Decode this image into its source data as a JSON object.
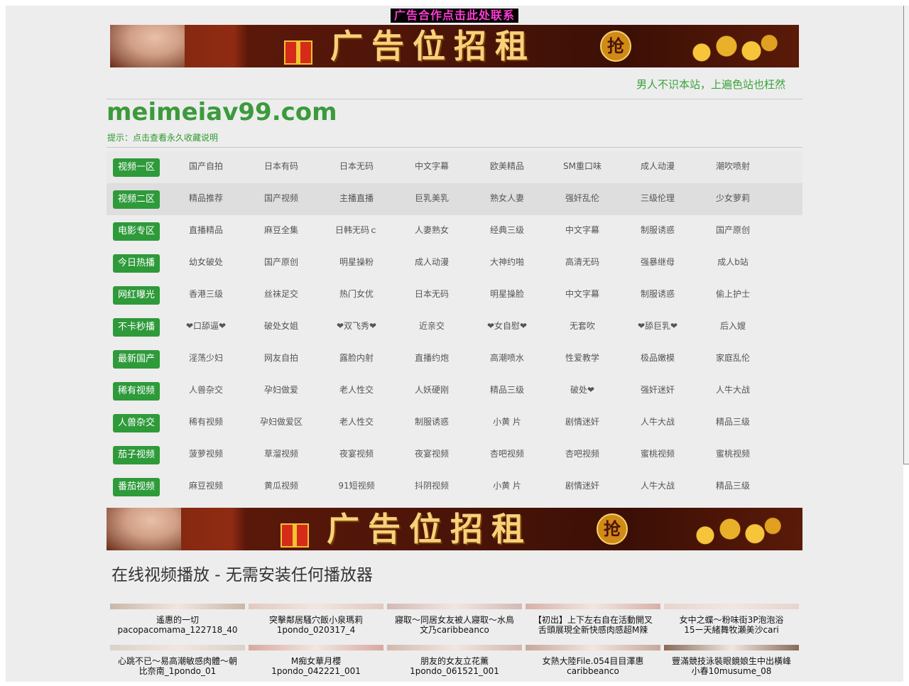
{
  "top_ad_link": "广告合作点击此处联系",
  "banner": {
    "slogan": "广告位招租",
    "badge": "抢"
  },
  "tagline": "男人不识本站，上遍色站也枉然",
  "logo": "meimeiav99.com",
  "hint": "提示：点击查看永久收藏说明",
  "nav": [
    {
      "zone": "视频一区",
      "links": [
        "国产自拍",
        "日本有码",
        "日本无码",
        "中文字幕",
        "欧美精品",
        "SM重口味",
        "成人动漫",
        "潮吹喷射"
      ]
    },
    {
      "zone": "视频二区",
      "links": [
        "精品推荐",
        "国产视频",
        "主播直播",
        "巨乳美乳",
        "熟女人妻",
        "强奸乱伦",
        "三级伦理",
        "少女萝莉"
      ]
    },
    {
      "zone": "电影专区",
      "links": [
        "直播精品",
        "麻豆全集",
        "日韩无码ｃ",
        "人妻熟女",
        "经典三级",
        "中文字幕",
        "制服诱惑",
        "国产原创"
      ]
    },
    {
      "zone": "今日热播",
      "links": [
        "幼女破处",
        "国产原创",
        "明星操粉",
        "成人动漫",
        "大神约啪",
        "高清无码",
        "强暴继母",
        "成人b站"
      ]
    },
    {
      "zone": "网红曝光",
      "links": [
        "香港三级",
        "丝袜足交",
        "热门女优",
        "日本无码",
        "明星操脸",
        "中文字幕",
        "制服诱惑",
        "偷上护士"
      ]
    },
    {
      "zone": "不卡秒播",
      "links": [
        "❤口舔逼❤",
        "破处女姐",
        "❤双飞秀❤",
        "近亲交",
        "❤女自慰❤",
        "无套吹",
        "❤舔巨乳❤",
        "后入嫂"
      ]
    },
    {
      "zone": "最新国产",
      "links": [
        "淫荡少妇",
        "网友自拍",
        "露脸内射",
        "直播约炮",
        "高潮喷水",
        "性爱教学",
        "极品嫩模",
        "家庭乱伦"
      ]
    },
    {
      "zone": "稀有视频",
      "links": [
        "人兽杂交",
        "孕妇做爱",
        "老人性交",
        "人妖硬刚",
        "精品三级",
        "破处❤",
        "强奸迷奸",
        "人牛大战"
      ]
    },
    {
      "zone": "人兽杂交",
      "links": [
        "稀有视频",
        "孕妇做爱区",
        "老人性交",
        "制服诱惑",
        "小黄 片",
        "剧情迷奸",
        "人牛大战",
        "精品三级"
      ]
    },
    {
      "zone": "茄子视频",
      "links": [
        "菠萝视频",
        "草溜视频",
        "夜宴视频",
        "夜宴视频",
        "杏吧视频",
        "杏吧视频",
        "蜜桃视频",
        "蜜桃视频"
      ]
    },
    {
      "zone": "番茄视频",
      "links": [
        "麻豆视频",
        "黄瓜视频",
        "91短视频",
        "抖阴视频",
        "小黄 片",
        "剧情迷奸",
        "人牛大战",
        "精品三级"
      ]
    }
  ],
  "section_title": "在线视频播放 - 无需安装任何播放器",
  "videos": [
    [
      "遙惠的一切\npacopacomama_122718_40",
      "突擊鄰居騷穴飯小泉瑪莉\n1pondo_020317_4",
      "寢取～同居女友被人寢取～水鳥\n文乃caribbeanco",
      "【初出】上下左右自在活動開叉\n舌頭展現全新快感肉感超M辣",
      "女中之蝶～粉味街3P泡泡浴\n15ー天緒舞牧瀬美沙cari"
    ],
    [
      "心跳不已～易高潮敏感肉體～朝\n比奈南_1pondo_01",
      "M痴女華月櫻\n1pondo_042221_001",
      "朋友的女友立花薫\n1pondo_061521_001",
      "女熱大陸File.054目目澤惠\ncaribbeanco",
      "豐滿競技泳裝眼鏡娘生中出橫峰\n小春10musume_08"
    ]
  ],
  "colors": {
    "accent_green": "#2e9a3a",
    "logo_green": "#3c9a3c",
    "ad_magenta": "#ff3bd6",
    "page_bg": "#ededed"
  }
}
